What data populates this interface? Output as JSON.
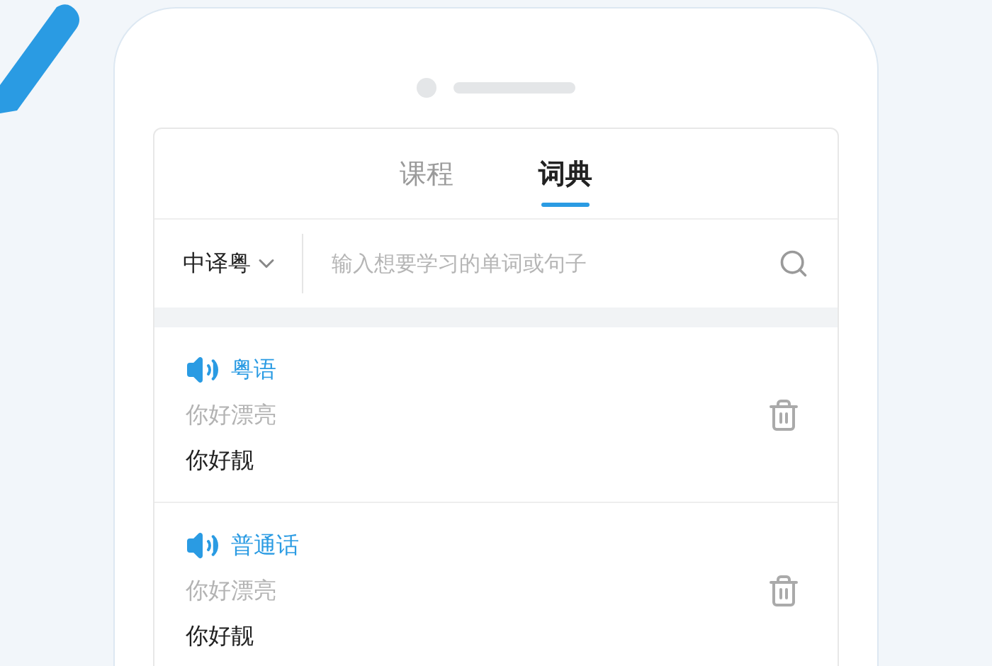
{
  "tabs": [
    {
      "label": "课程",
      "selected": false
    },
    {
      "label": "词典",
      "selected": true
    }
  ],
  "search": {
    "language": "中译粤",
    "placeholder": "输入想要学习的单词或句子"
  },
  "entries": [
    {
      "language": "粤语",
      "source": "你好漂亮",
      "translation": "你好靓"
    },
    {
      "language": "普通话",
      "source": "你好漂亮",
      "translation": "你好靓"
    }
  ]
}
